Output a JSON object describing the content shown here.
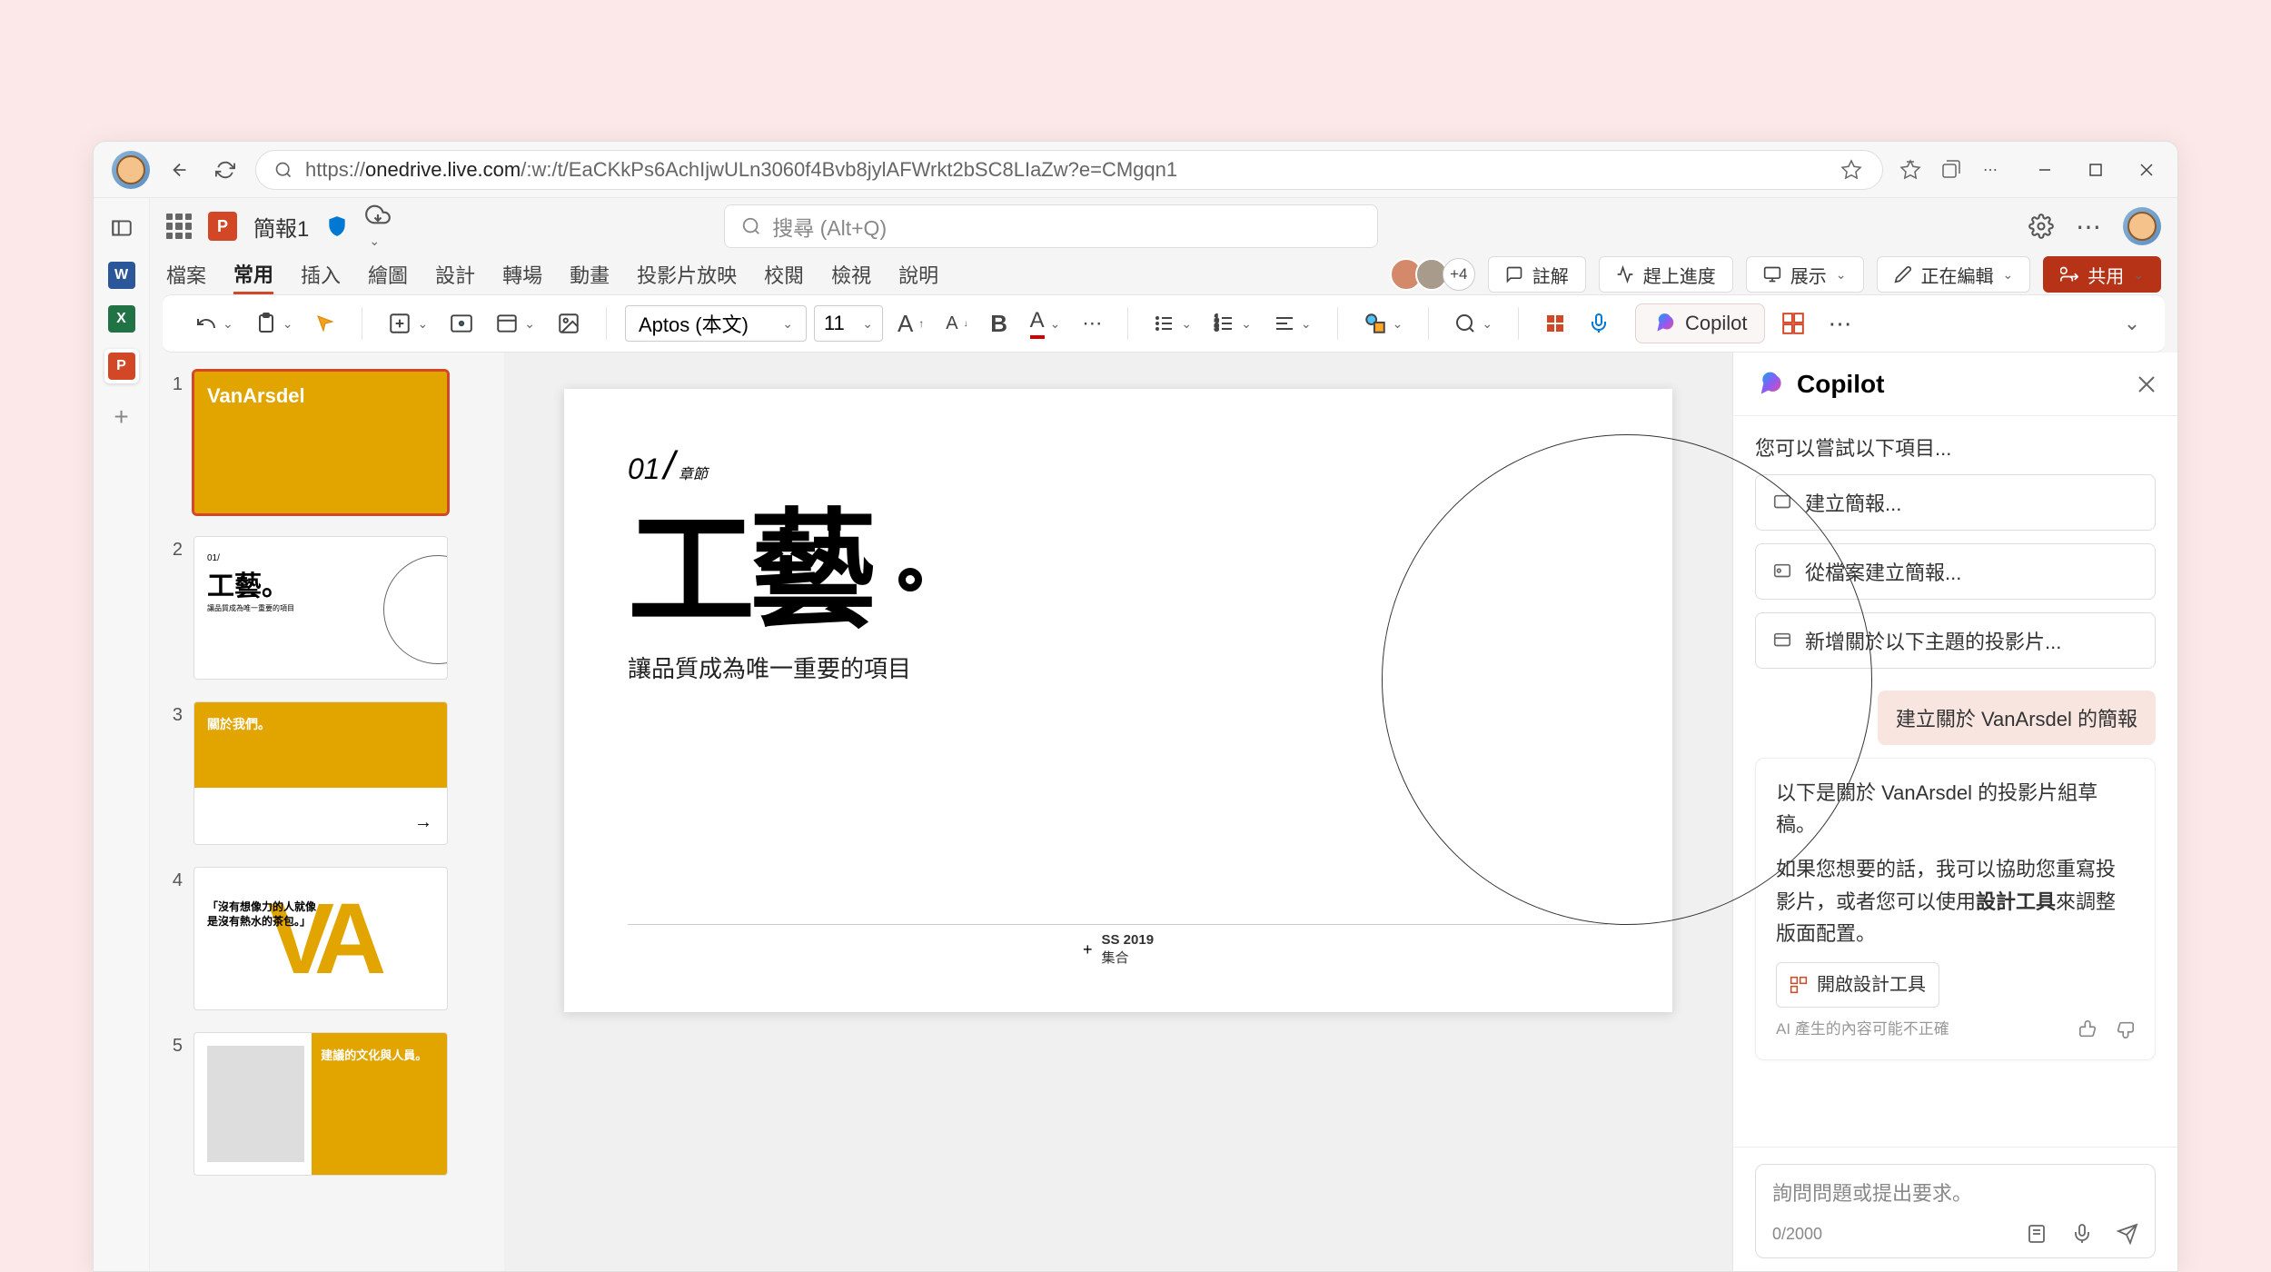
{
  "browser": {
    "url_host": "onedrive.live.com",
    "url_path": "/:w:/t/EaCKkPs6AchIjwULn3060f4Bvb8jylAFWrkt2bSC8LIaZw?e=CMgqn1",
    "url_prefix": "https://"
  },
  "app": {
    "doc_title": "簡報1",
    "search_placeholder": "搜尋 (Alt+Q)"
  },
  "ribbon": {
    "tabs": [
      "檔案",
      "常用",
      "插入",
      "繪圖",
      "設計",
      "轉場",
      "動畫",
      "投影片放映",
      "校閱",
      "檢視",
      "說明"
    ],
    "active_index": 1,
    "avatars_more": "+4",
    "comments": "註解",
    "catchup": "趕上進度",
    "present": "展示",
    "editing": "正在編輯",
    "share": "共用"
  },
  "toolbar": {
    "font_name": "Aptos (本文)",
    "font_size": "11",
    "copilot": "Copilot"
  },
  "slides": {
    "items": [
      {
        "num": "1"
      },
      {
        "num": "2"
      },
      {
        "num": "3"
      },
      {
        "num": "4"
      },
      {
        "num": "5"
      }
    ],
    "thumb1_brand": "VanArsdel",
    "thumb2_title": "工藝。",
    "thumb2_sub": "讓品質成為唯一重要的項目",
    "thumb3_title": "關於我們。",
    "thumb4_quote": "「沒有想像力的人就像是沒有熱水的茶包。」",
    "thumb5_title": "建議的文化與人員。"
  },
  "slide": {
    "section_num": "01",
    "section_label": "章節",
    "title": "工藝",
    "subtitle": "讓品質成為唯一重要的項目",
    "footer_year": "SS 2019",
    "footer_label": "集合",
    "footer_plus": "+"
  },
  "copilot": {
    "title": "Copilot",
    "try_label": "您可以嘗試以下項目...",
    "suggestions": [
      "建立簡報...",
      "從檔案建立簡報...",
      "新增關於以下主題的投影片..."
    ],
    "user_message": "建立關於 VanArsdel 的簡報",
    "response_1": "以下是關於 VanArsdel 的投影片組草稿。",
    "response_2_a": "如果您想要的話，我可以協助您重寫投影片，或者您可以使用",
    "response_2_b": "設計工具",
    "response_2_c": "來調整版面配置。",
    "open_designer": "開啟設計工具",
    "disclaimer": "AI 產生的內容可能不正確",
    "input_placeholder": "詢問問題或提出要求。",
    "char_count": "0/2000"
  }
}
